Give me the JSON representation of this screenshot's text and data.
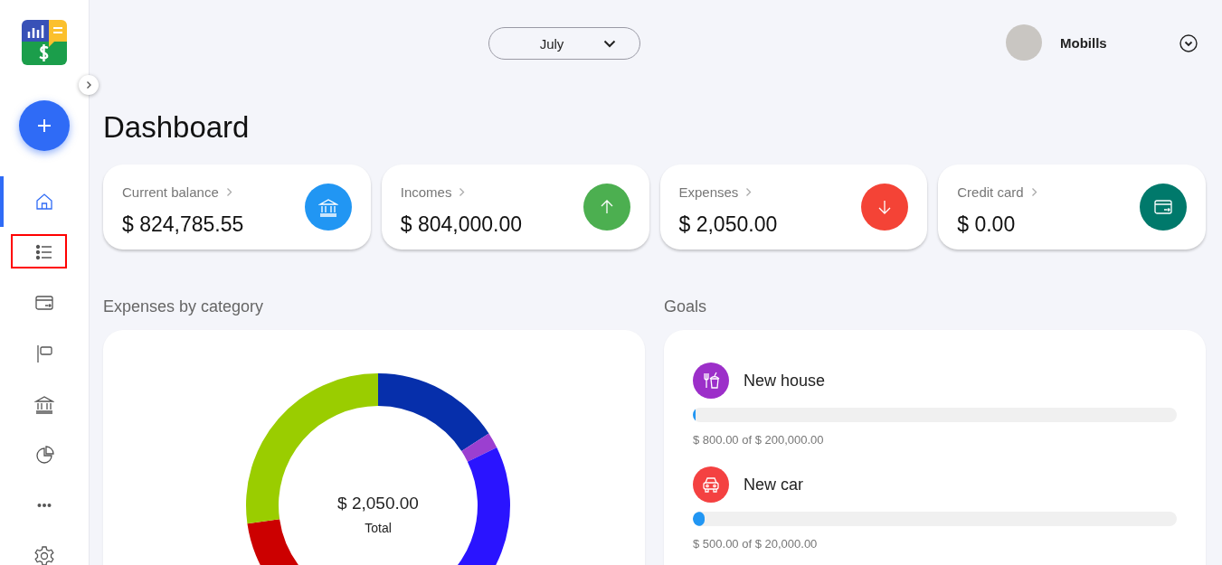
{
  "sidebar": {
    "nav_items": [
      {
        "kind": "home",
        "selected": true,
        "highlighted": false
      },
      {
        "kind": "list",
        "selected": false,
        "highlighted": true
      },
      {
        "kind": "card",
        "selected": false,
        "highlighted": false
      },
      {
        "kind": "flag",
        "selected": false,
        "highlighted": false
      },
      {
        "kind": "bank",
        "selected": false,
        "highlighted": false
      },
      {
        "kind": "pie",
        "selected": false,
        "highlighted": false
      },
      {
        "kind": "more",
        "selected": false,
        "highlighted": false
      },
      {
        "kind": "settings",
        "selected": false,
        "highlighted": false
      }
    ]
  },
  "header": {
    "month": "July",
    "user_name": "Mobills"
  },
  "title": "Dashboard",
  "cards": [
    {
      "label": "Current balance",
      "value": "$ 824,785.55",
      "kind": "bank",
      "color": "#2196f3"
    },
    {
      "label": "Incomes",
      "value": "$ 804,000.00",
      "kind": "up",
      "color": "#4caf50"
    },
    {
      "label": "Expenses",
      "value": "$ 2,050.00",
      "kind": "down",
      "color": "#f44336"
    },
    {
      "label": "Credit card",
      "value": "$ 0.00",
      "kind": "card",
      "color": "#00796b"
    }
  ],
  "expenses_by_category": {
    "title": "Expenses by category",
    "total": "$ 2,050.00",
    "total_label": "Total"
  },
  "goals": {
    "title": "Goals",
    "items": [
      {
        "name": "New house",
        "kind": "food",
        "color": "#9c2fc9",
        "level": 0.004,
        "progress": "$ 800.00 of $ 200,000.00"
      },
      {
        "name": "New car",
        "kind": "car",
        "color": "#f44141",
        "level": 0.025,
        "progress": "$ 500.00 of $ 20,000.00"
      }
    ]
  }
}
